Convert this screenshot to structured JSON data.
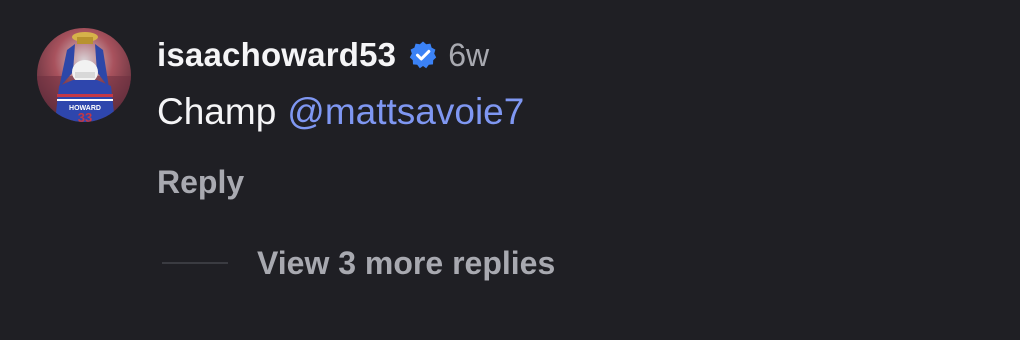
{
  "comment": {
    "author": "isaachoward53",
    "verified": true,
    "age": "6w",
    "text": "Champ",
    "mention": "@mattsavoie7",
    "reply_label": "Reply",
    "avatar_jersey_text": "HOWARD",
    "avatar_jersey_number": "33"
  },
  "replies": {
    "view_more_label": "View 3 more replies"
  },
  "colors": {
    "background": "#1f1f24",
    "primary_text": "#f5f5f7",
    "secondary_text": "#a8a9b0",
    "mention": "#7f97f2",
    "verified_badge": "#3b82f6",
    "divider": "#3a3b41"
  }
}
